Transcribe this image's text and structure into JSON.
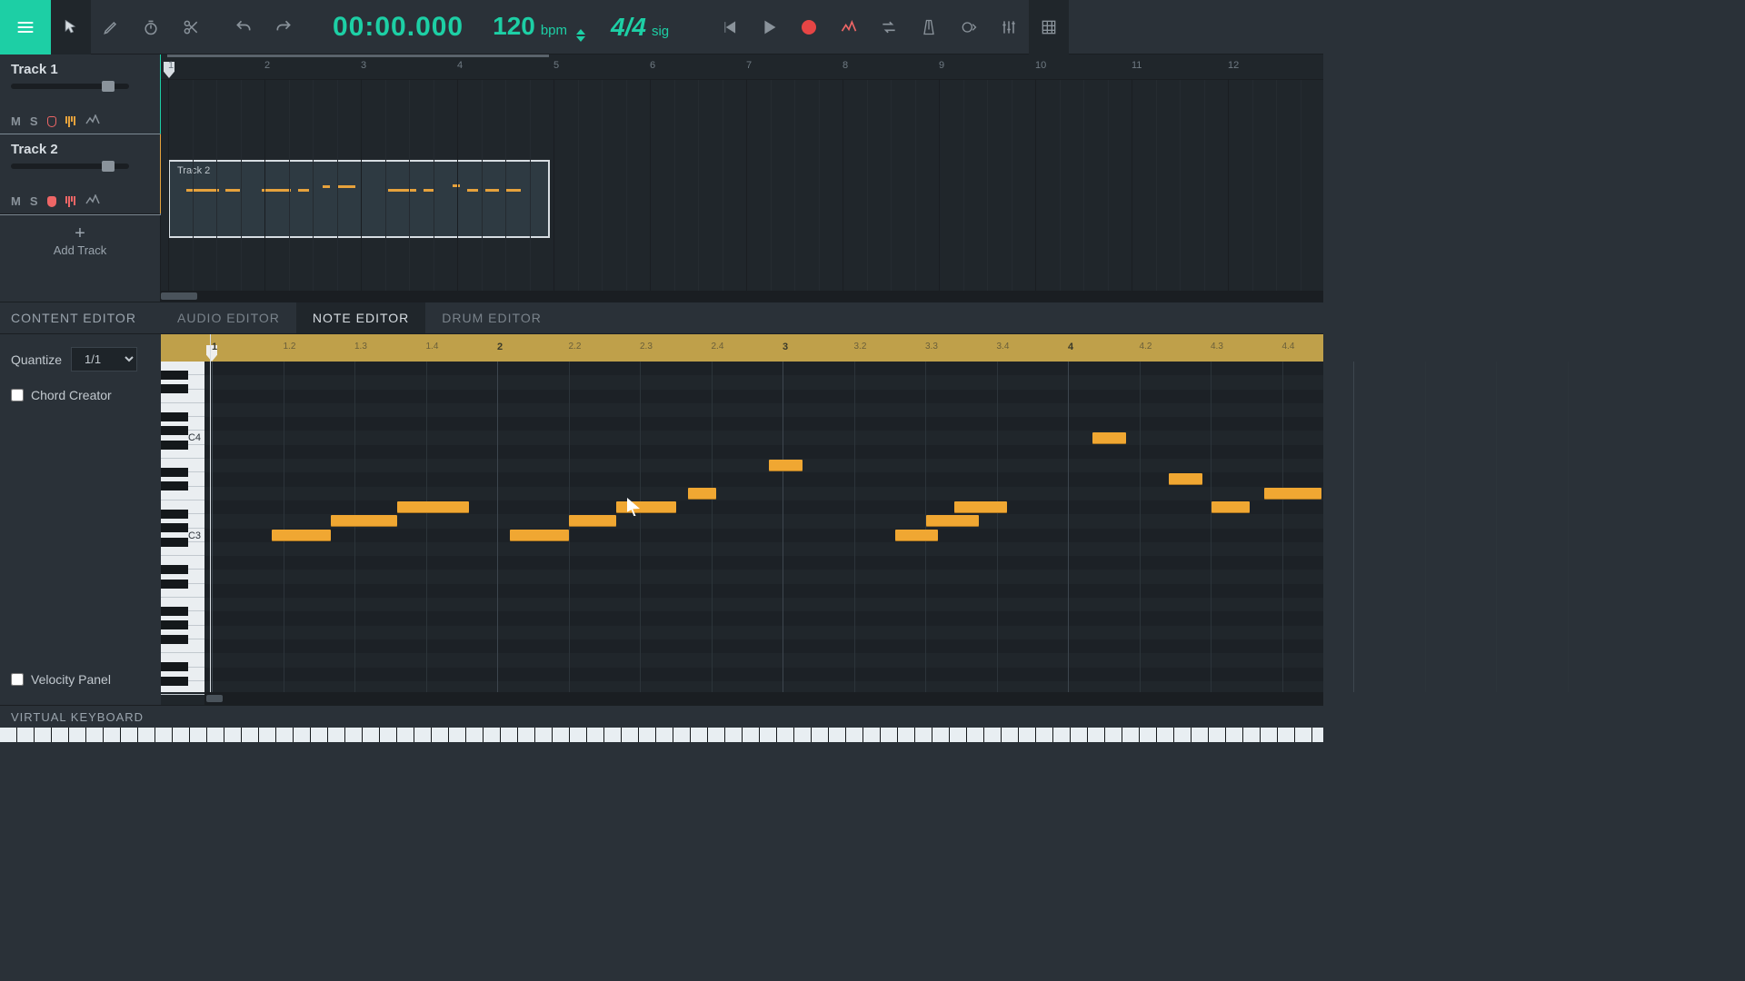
{
  "toolbar": {
    "time": "00:00.000",
    "bpm": "120",
    "bpm_label": "bpm",
    "sig": "4/4",
    "sig_label": "sig"
  },
  "tracks": [
    {
      "name": "Track 1",
      "mute": "M",
      "solo": "S"
    },
    {
      "name": "Track 2",
      "mute": "M",
      "solo": "S",
      "clip": "Track 2"
    }
  ],
  "add_track": "Add Track",
  "timeline_bars": [
    "1",
    "2",
    "3",
    "4",
    "5",
    "6",
    "7",
    "8",
    "9",
    "10",
    "11",
    "12"
  ],
  "editor": {
    "side_title": "CONTENT EDITOR",
    "tabs": [
      "AUDIO EDITOR",
      "NOTE EDITOR",
      "DRUM EDITOR"
    ],
    "active_tab": 1,
    "quantize_label": "Quantize",
    "quantize_value": "1/1",
    "chord_creator": "Chord Creator",
    "velocity_panel": "Velocity Panel"
  },
  "ne_ruler": {
    "bars": [
      "1",
      "2",
      "3",
      "4"
    ],
    "subs": [
      "1.2",
      "1.3",
      "1.4",
      "2.2",
      "2.3",
      "2.4",
      "3.2",
      "3.3",
      "3.4",
      "4.2",
      "4.3",
      "4.4"
    ]
  },
  "piano_labels": {
    "c4": "C4",
    "c3": "C3"
  },
  "bottom": "VIRTUAL KEYBOARD",
  "notes": [
    {
      "row": 12,
      "start": 0.25,
      "len": 0.25
    },
    {
      "row": 11,
      "start": 0.5,
      "len": 0.28
    },
    {
      "row": 10,
      "start": 0.78,
      "len": 0.3
    },
    {
      "row": 12,
      "start": 1.25,
      "len": 0.25
    },
    {
      "row": 11,
      "start": 1.5,
      "len": 0.2
    },
    {
      "row": 10,
      "start": 1.7,
      "len": 0.25
    },
    {
      "row": 9,
      "start": 2.0,
      "len": 0.12
    },
    {
      "row": 7,
      "start": 2.34,
      "len": 0.14
    },
    {
      "row": 12,
      "start": 2.87,
      "len": 0.18
    },
    {
      "row": 11,
      "start": 3.0,
      "len": 0.22
    },
    {
      "row": 10,
      "start": 3.12,
      "len": 0.22
    },
    {
      "row": 5,
      "start": 3.7,
      "len": 0.14
    },
    {
      "row": 8,
      "start": 4.02,
      "len": 0.14
    },
    {
      "row": 10,
      "start": 4.2,
      "len": 0.16
    },
    {
      "row": 9,
      "start": 4.42,
      "len": 0.24
    }
  ]
}
